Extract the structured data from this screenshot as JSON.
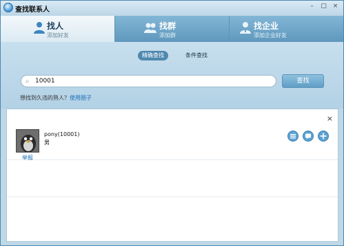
{
  "window": {
    "title": "查找联系人",
    "controls": [
      "–",
      "□",
      "×"
    ]
  },
  "tabs": [
    {
      "label": "找人",
      "sub": "添加好友",
      "icon": "person-icon",
      "active": true
    },
    {
      "label": "找群",
      "sub": "添加群",
      "icon": "group-icon",
      "active": false
    },
    {
      "label": "找企业",
      "sub": "添加企业好友",
      "icon": "enterprise-icon",
      "active": false
    }
  ],
  "search": {
    "mode_exact": "精确查找",
    "mode_condition": "条件查找",
    "value": "10001",
    "button": "查找",
    "hint_prefix": "想找到久违的熟人？",
    "hint_link": "使用圈子"
  },
  "results": {
    "close": "×",
    "items": [
      {
        "name": "pony(10001)",
        "gender": "男",
        "report": "举报"
      }
    ],
    "action_icons": [
      "profile-card-icon",
      "chat-bubble-icon",
      "add-friend-icon"
    ]
  },
  "colors": {
    "accent": "#5da2d2",
    "link": "#1b6fb8",
    "tab_inactive": "#6fa6c8",
    "panel": "#bfd8e7"
  }
}
